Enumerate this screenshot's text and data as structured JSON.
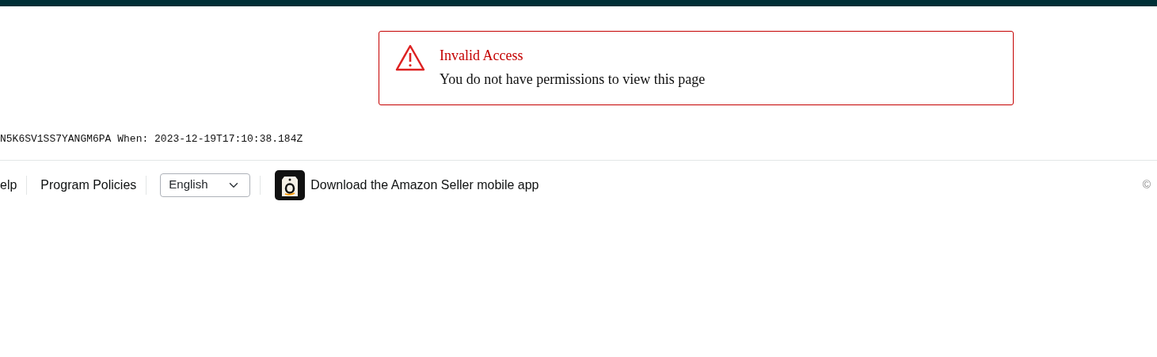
{
  "alert": {
    "title": "Invalid Access",
    "message": "You do not have permissions to view this page"
  },
  "request_info": "N5K6SV1SS7YANGM6PA When: 2023-12-19T17:10:38.184Z",
  "footer": {
    "links": [
      "elp",
      "Program Policies"
    ],
    "language": {
      "value": "English"
    },
    "app_link": "Download the Amazon Seller mobile app",
    "copyright": "©"
  }
}
